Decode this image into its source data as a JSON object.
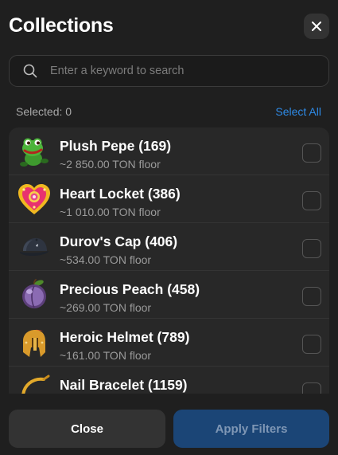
{
  "header": {
    "title": "Collections"
  },
  "search": {
    "placeholder": "Enter a keyword to search",
    "value": ""
  },
  "selection": {
    "selected_text": "Selected: 0",
    "select_all_label": "Select All"
  },
  "collections": [
    {
      "name": "Plush Pepe (169)",
      "floor": "~2 850.00 TON floor",
      "icon": "frog-icon"
    },
    {
      "name": "Heart Locket (386)",
      "floor": "~1 010.00 TON floor",
      "icon": "heart-locket-icon"
    },
    {
      "name": "Durov's Cap (406)",
      "floor": "~534.00 TON floor",
      "icon": "cap-icon"
    },
    {
      "name": "Precious Peach (458)",
      "floor": "~269.00 TON floor",
      "icon": "peach-icon"
    },
    {
      "name": "Heroic Helmet (789)",
      "floor": "~161.00 TON floor",
      "icon": "helmet-icon"
    },
    {
      "name": "Nail Bracelet (1159)",
      "floor": "",
      "icon": "bracelet-icon"
    }
  ],
  "footer": {
    "close_label": "Close",
    "apply_label": "Apply Filters"
  },
  "colors": {
    "accent": "#2e8ae6",
    "apply_bg": "#1b4576",
    "panel": "#282828",
    "background": "#1f1f1f"
  }
}
